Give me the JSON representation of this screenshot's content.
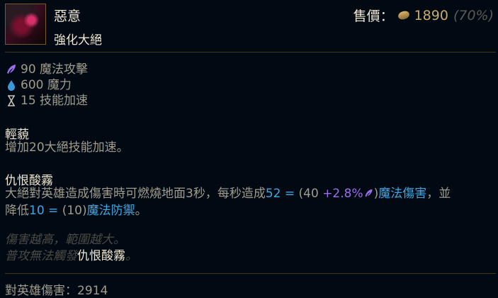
{
  "item": {
    "name": "惡意",
    "subtitle": "強化大絕",
    "sell_label": "售價：",
    "sell_price": "1890",
    "sell_percent": "(70%)"
  },
  "stats": [
    {
      "icon": "ability-power-icon",
      "text": "90 魔法攻擊"
    },
    {
      "icon": "mana-icon",
      "text": "600 魔力"
    },
    {
      "icon": "ability-haste-icon",
      "text": "15 技能加速"
    }
  ],
  "passive1": {
    "title": "輕藐",
    "text": "增加20大絕技能加速。"
  },
  "passive2": {
    "title": "仇恨酸霧",
    "text_a": "大絕對英雄造成傷害時可燃燒地面3秒，每秒造成",
    "dmg_total": "52 = ",
    "dmg_paren_open": "(40 ",
    "dmg_ratio": "+2.8%",
    "dmg_paren_close": ")",
    "dmg_type": "魔法傷害",
    "text_b": "，並",
    "text_c": "降低",
    "mr_total": "10 = ",
    "mr_paren": "(10)",
    "mr_type": "魔法防禦",
    "text_d": "。"
  },
  "note": {
    "line1": "傷害越高，範圍越大。",
    "line2_a": "普攻無法觸發",
    "line2_hl": "仇恨酸霧",
    "line2_b": "。"
  },
  "footer": {
    "champion_damage_label": "對英雄傷害：",
    "champion_damage_value": "2914"
  },
  "colors": {
    "background": "#010a13",
    "gold": "#c8aa6e",
    "magic_blue": "#3ba8e3",
    "ap_purple": "#9b6de8",
    "text": "#a09b8c",
    "title": "#f0e6d2"
  }
}
